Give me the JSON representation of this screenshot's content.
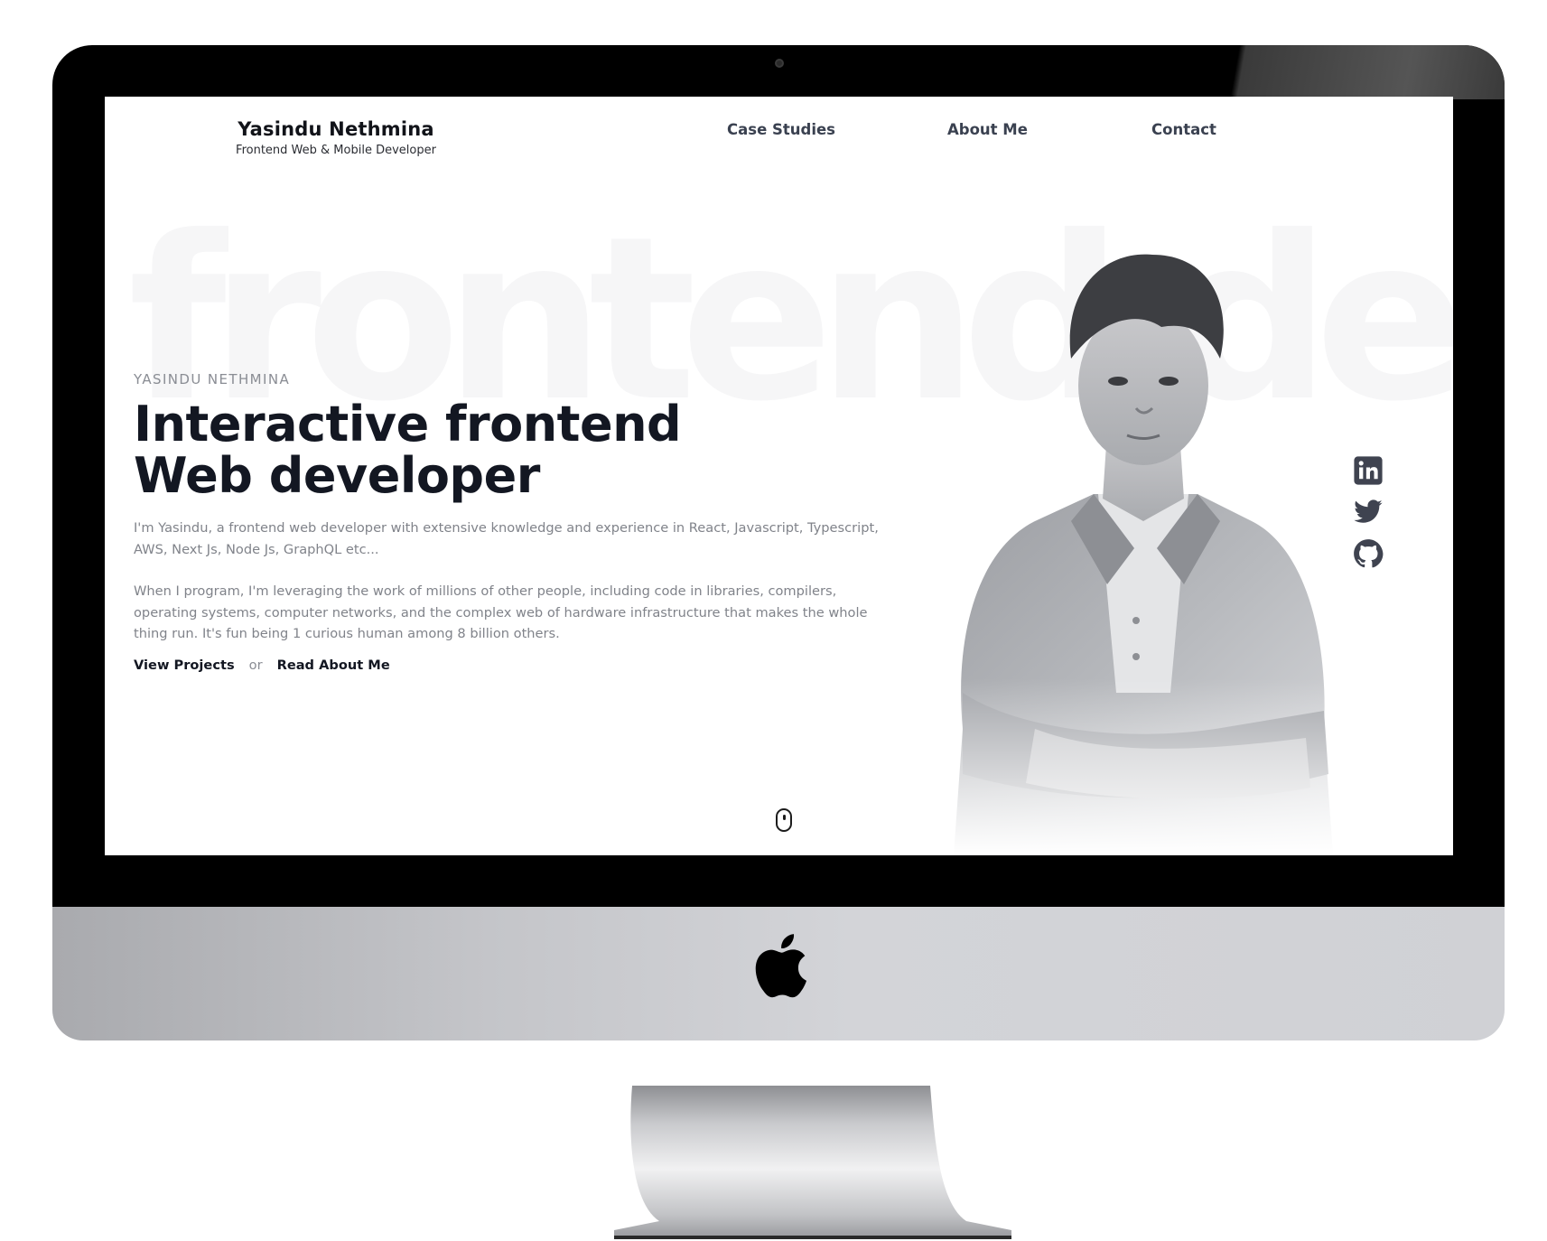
{
  "brand": {
    "name": "Yasindu Nethmina",
    "tagline": "Frontend Web & Mobile Developer"
  },
  "nav": {
    "items": [
      "Case Studies",
      "About Me",
      "Contact"
    ]
  },
  "background_text": "frontend dev.",
  "hero": {
    "eyebrow": "YASINDU NETHMINA",
    "headline_line1": "Interactive frontend",
    "headline_line2": "Web developer",
    "paragraph1": "I'm Yasindu, a frontend web developer with extensive knowledge and experience in React, Javascript, Typescript, AWS, Next Js, Node Js, GraphQL etc...",
    "paragraph2": "When I program, I'm leveraging the work of millions of other people, including code in libraries, compilers, operating systems, computer networks, and the complex web of hardware infrastructure that makes the whole thing run. It's fun being 1 curious human among 8 billion others.",
    "cta_primary": "View Projects",
    "cta_separator": "or",
    "cta_secondary": "Read About Me"
  },
  "socials": [
    {
      "icon": "linkedin-icon"
    },
    {
      "icon": "twitter-icon"
    },
    {
      "icon": "github-icon"
    }
  ],
  "colors": {
    "heading": "#131722",
    "body_text": "#80838a",
    "nav_text": "#3a4150",
    "social_icon": "#3f4350"
  }
}
